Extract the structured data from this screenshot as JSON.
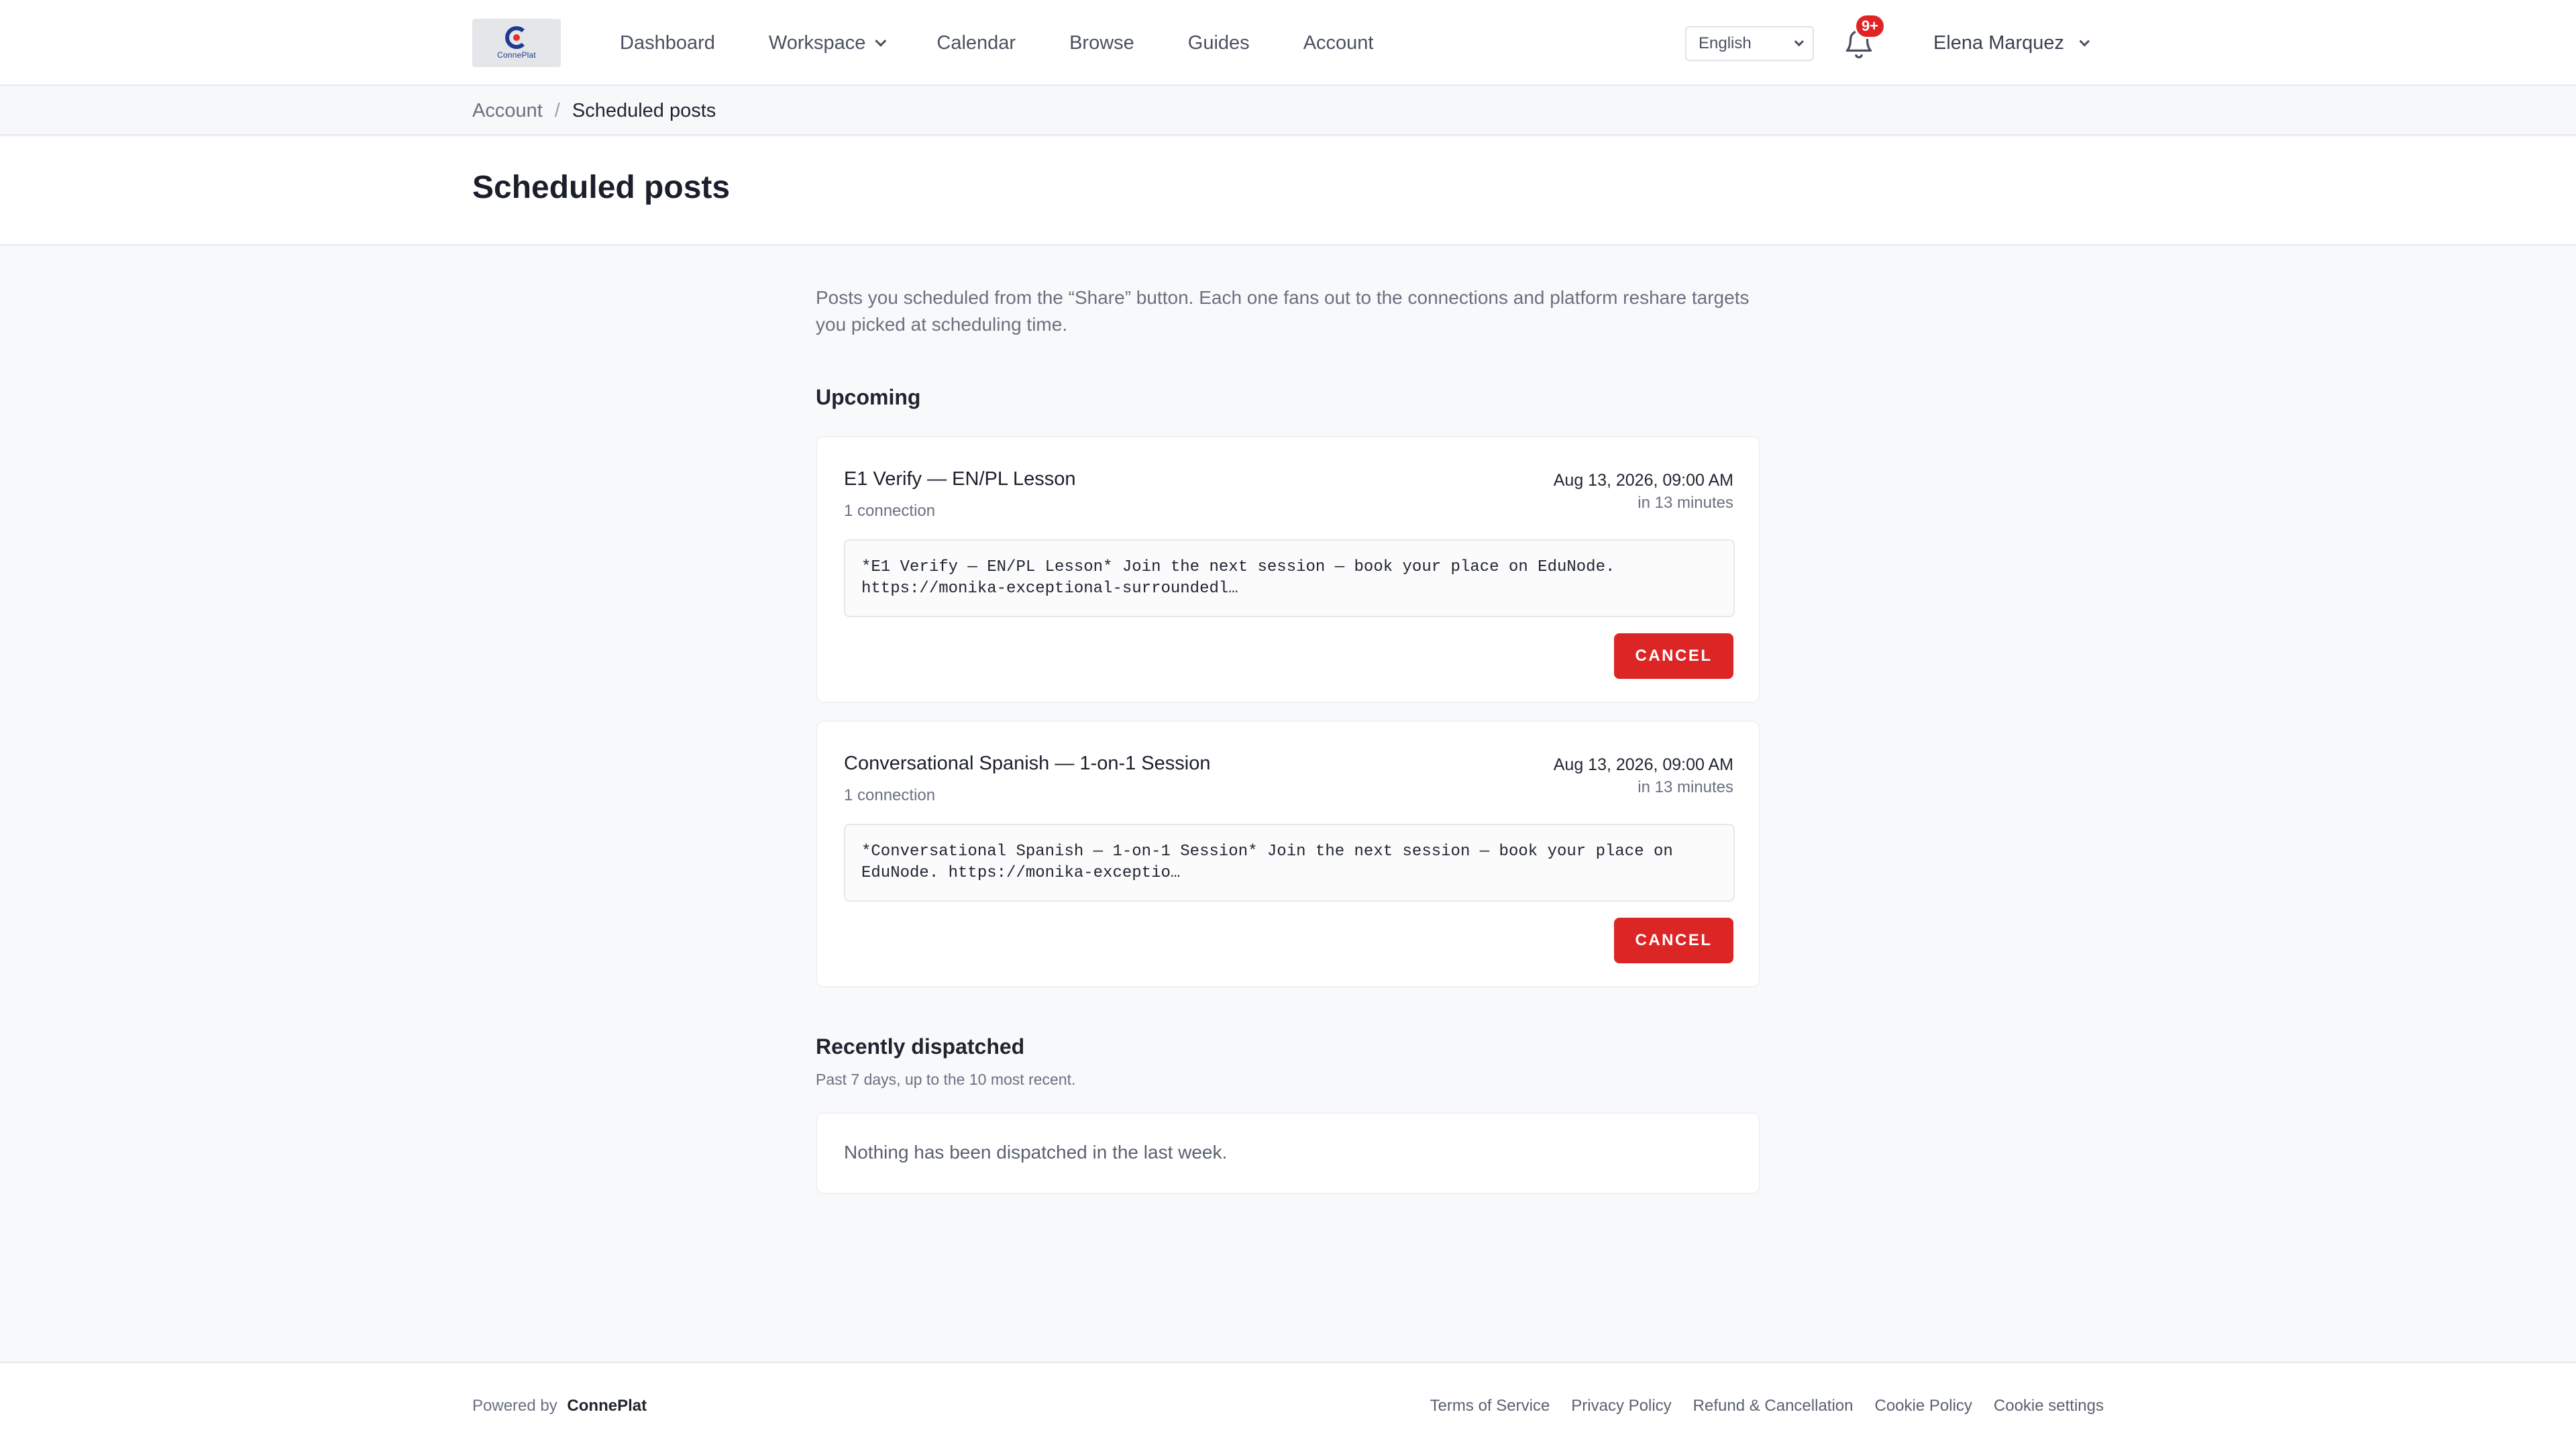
{
  "header": {
    "logo_text": "ConnePlat",
    "nav": [
      {
        "label": "Dashboard"
      },
      {
        "label": "Workspace",
        "has_dropdown": true
      },
      {
        "label": "Calendar"
      },
      {
        "label": "Browse"
      },
      {
        "label": "Guides"
      },
      {
        "label": "Account"
      }
    ],
    "language": "English",
    "notification_badge": "9+",
    "user_name": "Elena Marquez"
  },
  "breadcrumb": {
    "parent": "Account",
    "separator": "/",
    "current": "Scheduled posts"
  },
  "page": {
    "title": "Scheduled posts",
    "intro": "Posts you scheduled from the “Share” button. Each one fans out to the connections and platform reshare targets you picked at scheduling time."
  },
  "upcoming": {
    "title": "Upcoming",
    "posts": [
      {
        "title": "E1 Verify — EN/PL Lesson",
        "connections": "1 connection",
        "date": "Aug 13, 2026, 09:00 AM",
        "relative": "in 13 minutes",
        "body": "*E1 Verify — EN/PL Lesson* Join the next session — book your place on EduNode. https://monika-exceptional-surroundedl…",
        "cancel_label": "CANCEL"
      },
      {
        "title": "Conversational Spanish — 1-on-1 Session",
        "connections": "1 connection",
        "date": "Aug 13, 2026, 09:00 AM",
        "relative": "in 13 minutes",
        "body": "*Conversational Spanish — 1-on-1 Session* Join the next session — book your place on EduNode. https://monika-exceptio…",
        "cancel_label": "CANCEL"
      }
    ]
  },
  "dispatched": {
    "title": "Recently dispatched",
    "subtitle": "Past 7 days, up to the 10 most recent.",
    "empty_text": "Nothing has been dispatched in the last week."
  },
  "footer": {
    "powered_prefix": "Powered by",
    "powered_brand": "ConnePlat",
    "links": [
      "Terms of Service",
      "Privacy Policy",
      "Refund & Cancellation",
      "Cookie Policy",
      "Cookie settings"
    ]
  },
  "colors": {
    "accent_danger": "#dc2626",
    "badge": "#e02424",
    "brand_blue": "#1f3b8f"
  }
}
